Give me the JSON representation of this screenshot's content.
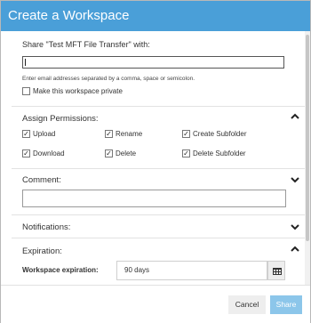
{
  "dialog": {
    "title": "Create a Workspace"
  },
  "share": {
    "label": "Share \"Test MFT File Transfer\" with:",
    "email_value": "",
    "hint": "Enter email addresses separated by a comma, space or semicolon.",
    "private_label": "Make this workspace private",
    "private_checked": false
  },
  "permissions": {
    "title": "Assign Permissions:",
    "items": [
      {
        "label": "Upload",
        "checked": true
      },
      {
        "label": "Rename",
        "checked": true
      },
      {
        "label": "Create Subfolder",
        "checked": true
      },
      {
        "label": "Download",
        "checked": true
      },
      {
        "label": "Delete",
        "checked": true
      },
      {
        "label": "Delete Subfolder",
        "checked": true
      }
    ]
  },
  "comment": {
    "title": "Comment:",
    "value": ""
  },
  "notifications": {
    "title": "Notifications:"
  },
  "expiration": {
    "title": "Expiration:",
    "field_label": "Workspace expiration:",
    "value": "90 days"
  },
  "footer": {
    "cancel_label": "Cancel",
    "share_label": "Share"
  },
  "colors": {
    "title_bar": "#4a9fd8",
    "share_button": "#8cc6ea"
  },
  "icons": {
    "check": "✓",
    "expanded": "chevron-up-icon",
    "collapsed": "chevron-down-icon",
    "calendar": "calendar-icon"
  }
}
